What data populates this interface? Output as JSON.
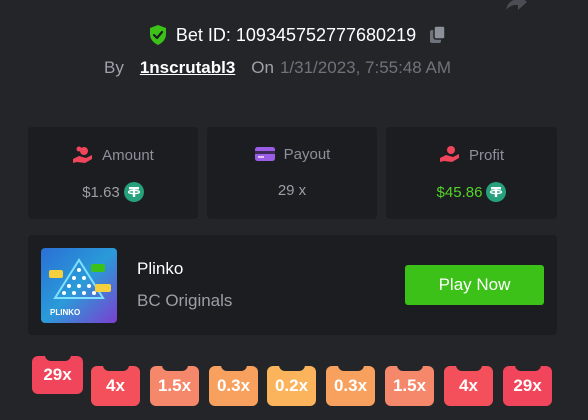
{
  "bet": {
    "id_text": "Bet ID: 109345752777680219",
    "by_label": "By",
    "username": "1nscrutabl3",
    "on_label": "On",
    "datetime": "1/31/2023, 7:55:48 AM"
  },
  "cards": {
    "amount": {
      "title": "Amount",
      "value": "$1.63"
    },
    "payout": {
      "title": "Payout",
      "value": "29 x"
    },
    "profit": {
      "title": "Profit",
      "value": "$45.86"
    }
  },
  "game": {
    "name": "Plinko",
    "provider": "BC Originals",
    "thumbnail_text": "PLINKO",
    "play_label": "Play Now"
  },
  "multipliers": [
    {
      "label": "29x",
      "color": "#f0455b",
      "selected": true
    },
    {
      "label": "4x",
      "color": "#f4505c",
      "selected": false
    },
    {
      "label": "1.5x",
      "color": "#f5876a",
      "selected": false
    },
    {
      "label": "0.3x",
      "color": "#f8a15e",
      "selected": false
    },
    {
      "label": "0.2x",
      "color": "#fbb45c",
      "selected": false
    },
    {
      "label": "0.3x",
      "color": "#f8a15e",
      "selected": false
    },
    {
      "label": "1.5x",
      "color": "#f5876a",
      "selected": false
    },
    {
      "label": "4x",
      "color": "#f4505c",
      "selected": false
    },
    {
      "label": "29x",
      "color": "#f0455b",
      "selected": false
    }
  ],
  "colors": {
    "background": "#232529",
    "card": "#1b1d21",
    "accent_green": "#3bc117",
    "profit_green": "#54d426",
    "tether": "#26a17b"
  }
}
